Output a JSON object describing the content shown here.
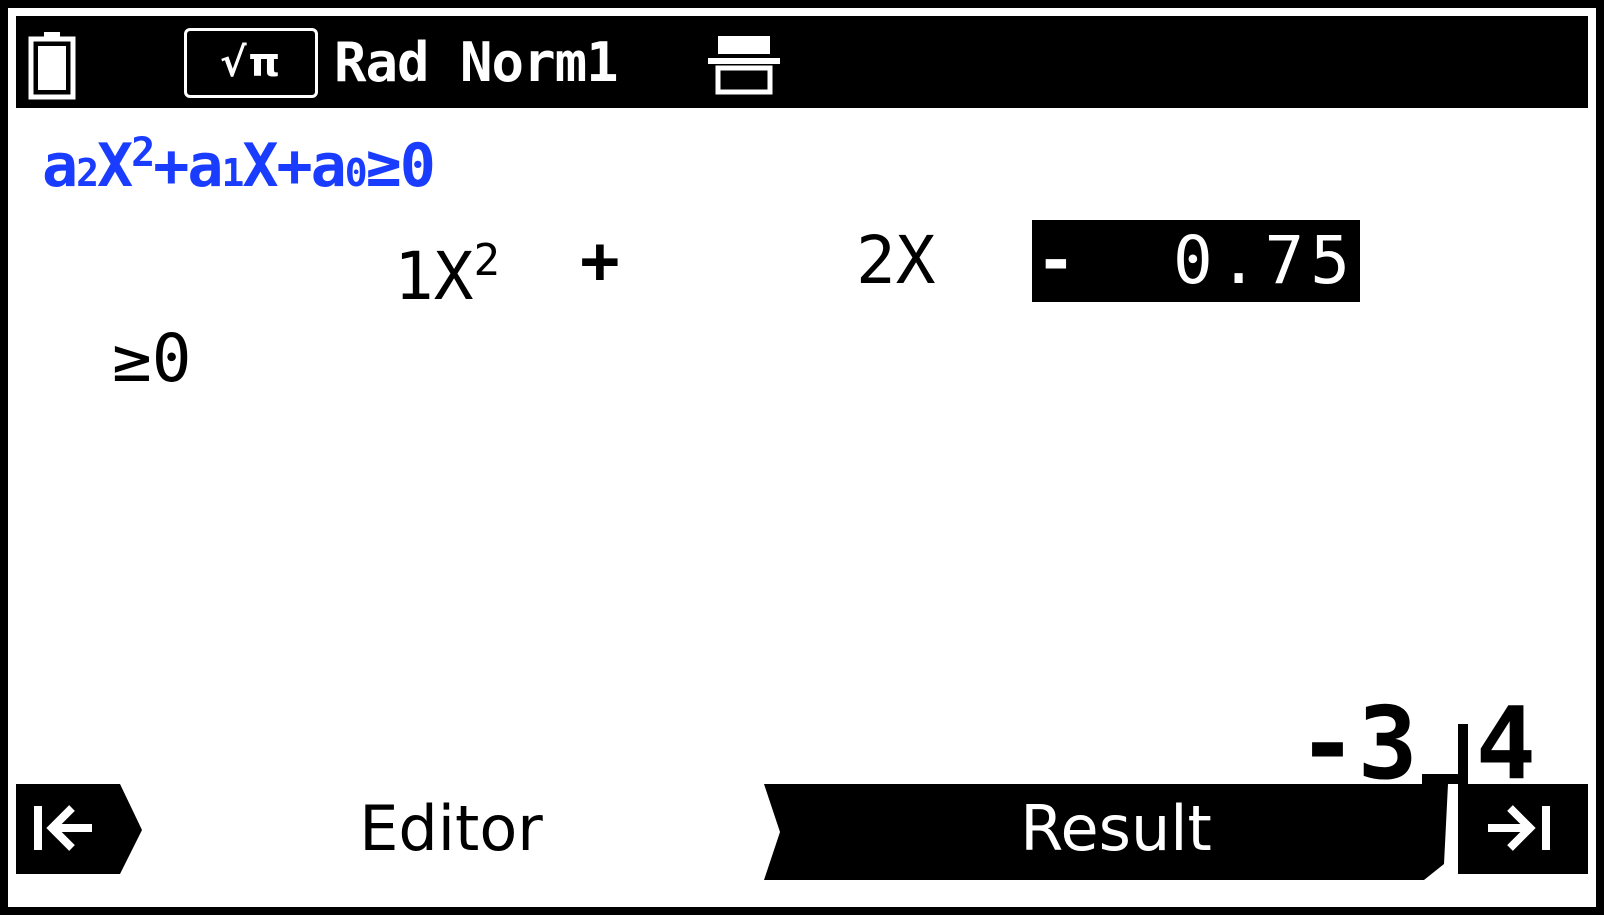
{
  "status_bar": {
    "mode_box": "√π",
    "status_text": "Rad Norm1",
    "icons": [
      "battery-icon",
      "display-icon"
    ]
  },
  "template": {
    "a2": "a",
    "a2_sub": "2",
    "x2": "X",
    "x2_sup": "2",
    "plus_a1": "+a",
    "a1_sub": "1",
    "x1_plus_a0": "X+a",
    "a0_sub": "0",
    "rel": "≥0"
  },
  "equation": {
    "a2_coef": "1",
    "a2_var": "X",
    "a2_sup": "2",
    "plus": "+",
    "a1_term": "2X",
    "a0_sign": "-",
    "a0_value": "0.75",
    "rhs": "≥0"
  },
  "result": {
    "whole": "-3",
    "denominator": "4"
  },
  "tabs": {
    "left_icon": "first-page-icon",
    "editor_label": "Editor",
    "result_label": "Result",
    "right_icon": "last-page-icon"
  },
  "colors": {
    "background": "#000000",
    "screen": "#ffffff",
    "template_blue": "#1a3cff"
  }
}
